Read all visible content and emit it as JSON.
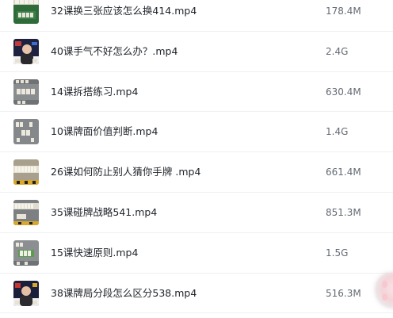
{
  "files": [
    {
      "name": "32课换三张应该怎么换414.mp4",
      "size": "178.4M",
      "thumb": "green-table"
    },
    {
      "name": "40课手气不好怎么办？.mp4",
      "size": "2.4G",
      "thumb": "presenter"
    },
    {
      "name": "14课拆搭练习.mp4",
      "size": "630.4M",
      "thumb": "gray-table"
    },
    {
      "name": "10课牌面价值判断.mp4",
      "size": "1.4G",
      "thumb": "gray-table"
    },
    {
      "name": "26课如何防止别人猜你手牌 .mp4",
      "size": "661.4M",
      "thumb": "tiles-row"
    },
    {
      "name": "35课碰牌战略541.mp4",
      "size": "851.3M",
      "thumb": "tiles-row"
    },
    {
      "name": "15课快速原则.mp4",
      "size": "1.5G",
      "thumb": "gray-green-table"
    },
    {
      "name": "38课牌局分段怎么区分538.mp4",
      "size": "516.3M",
      "thumb": "presenter"
    }
  ],
  "colors": {
    "text": "#1f2329",
    "size_text": "#646a73",
    "divider": "#eef0f3"
  }
}
